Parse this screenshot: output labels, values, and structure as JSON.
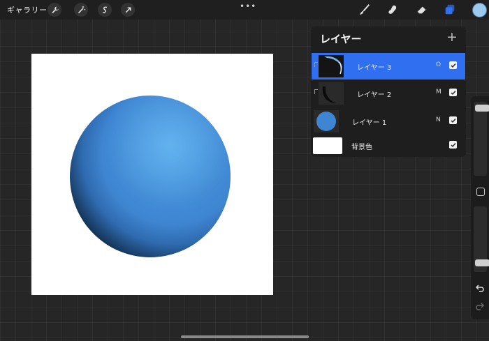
{
  "topbar": {
    "gallery_label": "ギャラリー",
    "left_tools": [
      "wrench-icon",
      "magic-wand-icon",
      "selection-s-icon",
      "transform-arrow-icon"
    ],
    "center_menu": "•••",
    "right_tools": [
      "brush-icon",
      "smudge-icon",
      "eraser-icon",
      "layers-icon"
    ],
    "current_color": "#9cc9ee"
  },
  "layers_panel": {
    "title": "レイヤー",
    "add_button": "+",
    "layers": [
      {
        "name": "レイヤー 3",
        "blend": "O",
        "visible": true,
        "selected": true,
        "clipped": true
      },
      {
        "name": "レイヤー 2",
        "blend": "M",
        "visible": true,
        "selected": false,
        "clipped": true
      },
      {
        "name": "レイヤー 1",
        "blend": "N",
        "visible": true,
        "selected": false,
        "clipped": false
      },
      {
        "name": "背景色",
        "blend": "",
        "visible": true,
        "selected": false,
        "clipped": false
      }
    ]
  },
  "sidebar": {
    "undo_icon": "undo-icon",
    "redo_icon": "redo-icon"
  },
  "colors": {
    "accent": "#2f6ff0",
    "sphere": "#3f86d2",
    "background": "#262626"
  }
}
